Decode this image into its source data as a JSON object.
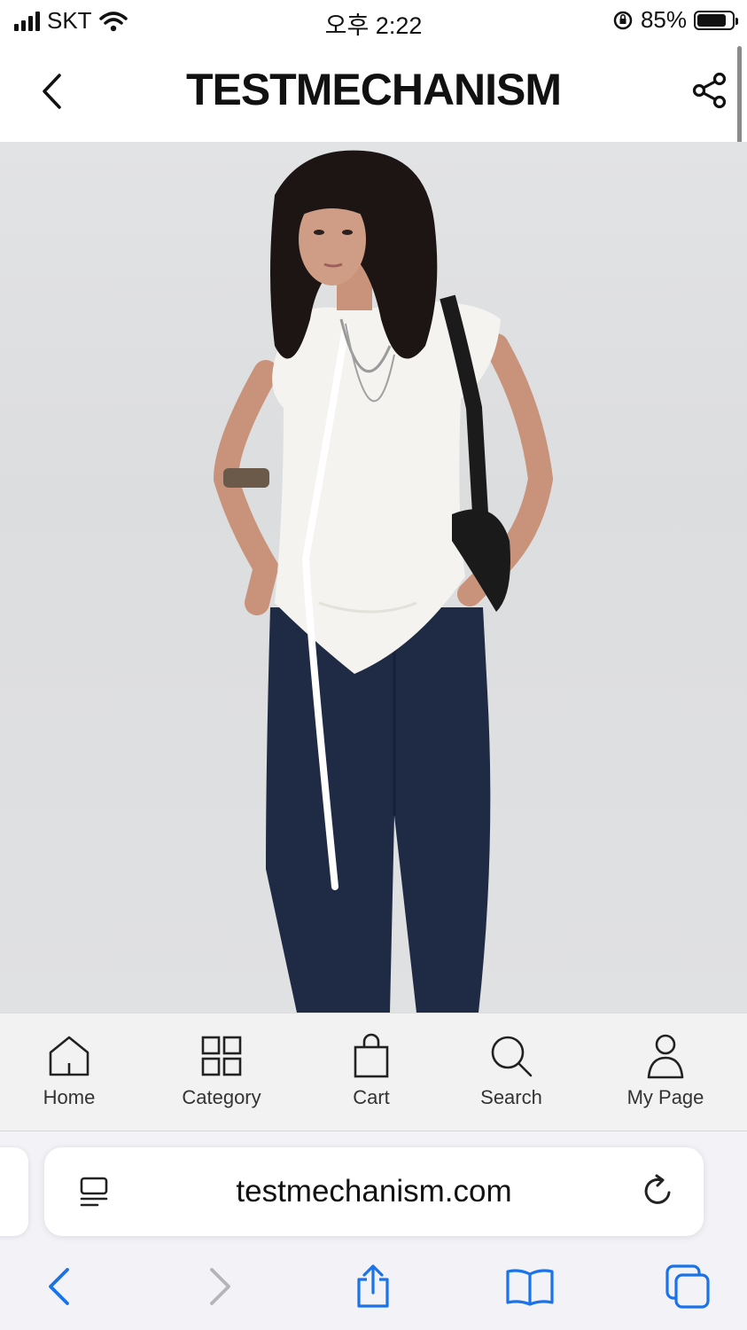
{
  "status_bar": {
    "carrier": "SKT",
    "time": "오후 2:22",
    "battery_percent": "85%",
    "battery_level": 0.85
  },
  "header": {
    "title": "TESTMECHANISM",
    "back_icon": "chevron-left-icon",
    "share_icon": "share-icon"
  },
  "hero": {
    "image": "model-photo",
    "scroll_top_icon": "arrow-up-to-top-icon"
  },
  "bottom_nav": {
    "items": [
      {
        "label": "Home",
        "icon": "home-icon"
      },
      {
        "label": "Category",
        "icon": "grid-icon"
      },
      {
        "label": "Cart",
        "icon": "bag-icon"
      },
      {
        "label": "Search",
        "icon": "search-icon"
      },
      {
        "label": "My Page",
        "icon": "user-icon"
      }
    ]
  },
  "browser": {
    "url": "testmechanism.com",
    "accent": "#1a73e8"
  }
}
